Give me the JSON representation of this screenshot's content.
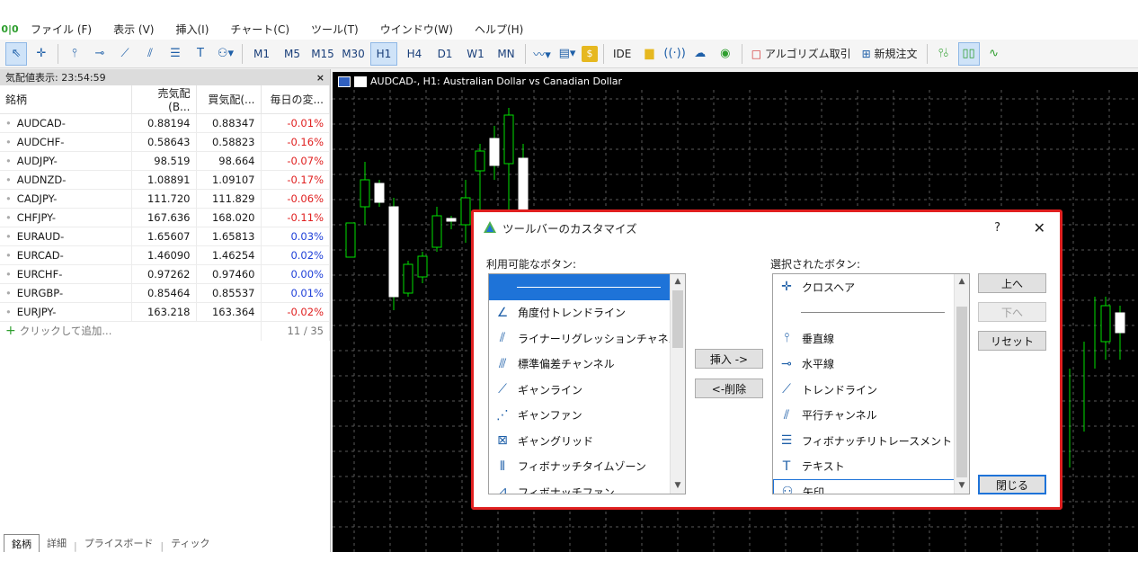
{
  "menu": {
    "items": [
      "ファイル (F)",
      "表示 (V)",
      "挿入(I)",
      "チャート(C)",
      "ツール(T)",
      "ウインドウ(W)",
      "ヘルプ(H)"
    ]
  },
  "toolbar": {
    "timeframes": [
      "M1",
      "M5",
      "M15",
      "M30",
      "H1",
      "H4",
      "D1",
      "W1",
      "MN"
    ],
    "selected_timeframe": "H1",
    "ide_label": "IDE",
    "algo_label": "アルゴリズム取引",
    "new_order_label": "新規注文"
  },
  "market_watch": {
    "title": "気配値表示: 23:54:59",
    "close": "×",
    "columns": [
      "銘柄",
      "売気配(B...",
      "買気配(...",
      "毎日の変..."
    ],
    "rows": [
      {
        "symbol": "AUDCAD-",
        "bid": "0.88194",
        "ask": "0.88347",
        "change": "-0.01%",
        "dir": "neg"
      },
      {
        "symbol": "AUDCHF-",
        "bid": "0.58643",
        "ask": "0.58823",
        "change": "-0.16%",
        "dir": "neg"
      },
      {
        "symbol": "AUDJPY-",
        "bid": "98.519",
        "ask": "98.664",
        "change": "-0.07%",
        "dir": "neg"
      },
      {
        "symbol": "AUDNZD-",
        "bid": "1.08891",
        "ask": "1.09107",
        "change": "-0.17%",
        "dir": "neg"
      },
      {
        "symbol": "CADJPY-",
        "bid": "111.720",
        "ask": "111.829",
        "change": "-0.06%",
        "dir": "neg"
      },
      {
        "symbol": "CHFJPY-",
        "bid": "167.636",
        "ask": "168.020",
        "change": "-0.11%",
        "dir": "neg"
      },
      {
        "symbol": "EURAUD-",
        "bid": "1.65607",
        "ask": "1.65813",
        "change": "0.03%",
        "dir": "pos"
      },
      {
        "symbol": "EURCAD-",
        "bid": "1.46090",
        "ask": "1.46254",
        "change": "0.02%",
        "dir": "pos"
      },
      {
        "symbol": "EURCHF-",
        "bid": "0.97262",
        "ask": "0.97460",
        "change": "0.00%",
        "dir": "pos"
      },
      {
        "symbol": "EURGBP-",
        "bid": "0.85464",
        "ask": "0.85537",
        "change": "0.01%",
        "dir": "pos"
      },
      {
        "symbol": "EURJPY-",
        "bid": "163.218",
        "ask": "163.364",
        "change": "-0.02%",
        "dir": "neg"
      }
    ],
    "add_label": "クリックして追加...",
    "count": "11 / 35",
    "tabs": [
      "銘柄",
      "詳細",
      "プライスボード",
      "ティック"
    ]
  },
  "chart": {
    "title": "AUDCAD-, H1:  Australian Dollar vs Canadian Dollar"
  },
  "dialog": {
    "title": "ツールバーのカスタマイズ",
    "help": "?",
    "close": "✕",
    "available_label": "利用可能なボタン:",
    "selected_label": "選択されたボタン:",
    "available": [
      {
        "label": "",
        "icon": "separator"
      },
      {
        "label": "角度付トレンドライン",
        "icon": "angle-trendline-icon"
      },
      {
        "label": "ライナーリグレッションチャネル",
        "icon": "regression-channel-icon"
      },
      {
        "label": "標準偏差チャンネル",
        "icon": "stddev-channel-icon"
      },
      {
        "label": "ギャンライン",
        "icon": "gann-line-icon"
      },
      {
        "label": "ギャンファン",
        "icon": "gann-fan-icon"
      },
      {
        "label": "ギャングリッド",
        "icon": "gann-grid-icon"
      },
      {
        "label": "フィボナッチタイムゾーン",
        "icon": "fibo-timezone-icon"
      },
      {
        "label": "フィボナッチファン",
        "icon": "fibo-fan-icon"
      }
    ],
    "selected": [
      {
        "label": "クロスヘア",
        "icon": "crosshair-icon"
      },
      {
        "label": "",
        "icon": "separator"
      },
      {
        "label": "垂直線",
        "icon": "vertical-line-icon"
      },
      {
        "label": "水平線",
        "icon": "horizontal-line-icon"
      },
      {
        "label": "トレンドライン",
        "icon": "trendline-icon"
      },
      {
        "label": "平行チャンネル",
        "icon": "parallel-channel-icon"
      },
      {
        "label": "フィボナッチリトレースメント",
        "icon": "fibo-retracement-icon"
      },
      {
        "label": "テキスト",
        "icon": "text-icon"
      },
      {
        "label": "矢印",
        "icon": "arrow-icon"
      }
    ],
    "insert_button": "挿入 ->",
    "delete_button": "<-削除",
    "up_button": "上へ",
    "down_button": "下へ",
    "reset_button": "リセット",
    "close_button": "閉じる"
  }
}
